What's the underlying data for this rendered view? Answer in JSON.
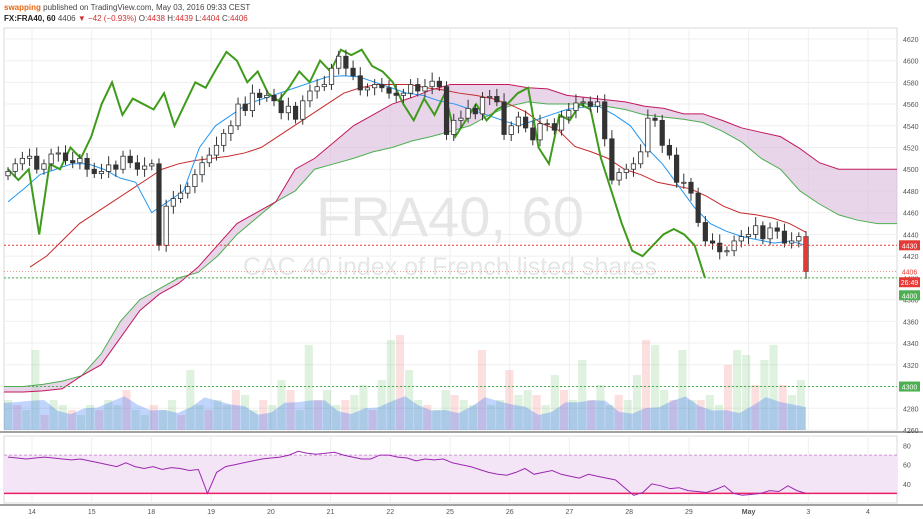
{
  "header": {
    "author": "swapping",
    "published_text": "published on TradingView.com, May 03, 2016 09:33 CEST",
    "symbol": "FX:FRA40, 60",
    "last": "4406",
    "change_arrow": "▼",
    "change": "−42 (−0.93%)",
    "o_label": "O:",
    "o": "4438",
    "h_label": "H:",
    "h": "4439",
    "l_label": "L:",
    "l": "4404",
    "c_label": "C:",
    "c": "4406"
  },
  "watermark": {
    "title": "FRA40, 60",
    "subtitle": "CAC 40 index of French listed shares"
  },
  "badges": {
    "level_upper": "4430",
    "last": "4406",
    "countdown": "26:49",
    "level_lower": "4400",
    "volume_level": "4300"
  },
  "colors": {
    "up": "#26a69a",
    "down": "#ef5350",
    "candle": "#333333",
    "lagging_span": "#3f9b1c",
    "cloud_fill": "#d7b2d9",
    "senkou_a": "#4caf50",
    "senkou_b": "#c2185b",
    "kijun": "#c62828",
    "tenkan": "#2196f3",
    "rsi": "#9c27b0",
    "rsi_band": "#f3e5f5"
  },
  "chart_data": {
    "type": "candlestick",
    "ylim": [
      4260,
      4630
    ],
    "y_ticks": [
      4260,
      4280,
      4300,
      4320,
      4340,
      4360,
      4380,
      4400,
      4420,
      4440,
      4460,
      4480,
      4500,
      4520,
      4540,
      4560,
      4580,
      4600,
      4620
    ],
    "x_ticks": [
      "14",
      "15",
      "18",
      "19",
      "20",
      "21",
      "22",
      "25",
      "26",
      "27",
      "28",
      "29",
      "May",
      "3",
      "4"
    ],
    "horizontal_lines": [
      4430,
      4400,
      4300
    ],
    "price_close": [
      4498,
      4505,
      4510,
      4512,
      4500,
      4505,
      4514,
      4515,
      4508,
      4506,
      4510,
      4500,
      4496,
      4498,
      4504,
      4500,
      4512,
      4506,
      4500,
      4503,
      4505,
      4430,
      4466,
      4473,
      4478,
      4484,
      4495,
      4506,
      4513,
      4522,
      4533,
      4540,
      4560,
      4554,
      4570,
      4566,
      4568,
      4563,
      4552,
      4558,
      4546,
      4563,
      4572,
      4576,
      4578,
      4593,
      4604,
      4593,
      4586,
      4573,
      4575,
      4578,
      4575,
      4570,
      4568,
      4570,
      4578,
      4572,
      4576,
      4581,
      4576,
      4532,
      4545,
      4547,
      4556,
      4551,
      4566,
      4567,
      4562,
      4532,
      4540,
      4548,
      4538,
      4527,
      4542,
      4542,
      4536,
      4548,
      4554,
      4561,
      4562,
      4558,
      4562,
      4528,
      4490,
      4497,
      4500,
      4505,
      4516,
      4547,
      4545,
      4522,
      4513,
      4488,
      4488,
      4478,
      4451,
      4434,
      4432,
      4424,
      4425,
      4434,
      4438,
      4440,
      4448,
      4436,
      4446,
      4443,
      4432,
      4434,
      4438,
      4406
    ],
    "senkou_a": [
      4300,
      4300,
      4302,
      4305,
      4310,
      4330,
      4360,
      4380,
      4390,
      4400,
      4405,
      4420,
      4440,
      4455,
      4470,
      4480,
      4500,
      4505,
      4510,
      4516,
      4520,
      4526,
      4530,
      4535,
      4540,
      4550,
      4558,
      4562,
      4560,
      4560,
      4560,
      4558,
      4555,
      4550,
      4548,
      4546,
      4543,
      4535,
      4525,
      4510,
      4500,
      4480,
      4468,
      4458,
      4453,
      4450,
      4450
    ],
    "senkou_b": [
      4295,
      4295,
      4296,
      4298,
      4310,
      4320,
      4345,
      4370,
      4385,
      4395,
      4410,
      4430,
      4450,
      4460,
      4470,
      4500,
      4510,
      4525,
      4540,
      4550,
      4560,
      4566,
      4573,
      4578,
      4578,
      4578,
      4578,
      4575,
      4574,
      4568,
      4566,
      4564,
      4562,
      4558,
      4556,
      4551,
      4551,
      4545,
      4538,
      4534,
      4530,
      4519,
      4506,
      4500,
      4500,
      4500,
      4500
    ],
    "kijun": [
      4410,
      4420,
      4435,
      4450,
      4460,
      4470,
      4480,
      4490,
      4500,
      4505,
      4508,
      4510,
      4512,
      4515,
      4520,
      4530,
      4540,
      4550,
      4560,
      4570,
      4575,
      4578,
      4578,
      4578,
      4575,
      4573,
      4570,
      4568,
      4565,
      4560,
      4553,
      4542,
      4536,
      4521,
      4516,
      4510,
      4500,
      4495,
      4488,
      4485,
      4482,
      4475,
      4466,
      4460,
      4458,
      4455,
      4450,
      4442
    ],
    "tenkan": [
      4470,
      4482,
      4495,
      4500,
      4505,
      4505,
      4500,
      4492,
      4488,
      4460,
      4470,
      4480,
      4520,
      4540,
      4550,
      4560,
      4565,
      4570,
      4575,
      4580,
      4585,
      4586,
      4585,
      4580,
      4575,
      4570,
      4568,
      4563,
      4560,
      4555,
      4550,
      4545,
      4540,
      4545,
      4550,
      4555,
      4557,
      4558,
      4550,
      4540,
      4520,
      4505,
      4485,
      4465,
      4450,
      4443,
      4438,
      4435,
      4432,
      4434,
      4430
    ],
    "lagging_span": [
      4500,
      4490,
      4500,
      4440,
      4505,
      4500,
      4520,
      4510,
      4530,
      4560,
      4580,
      4550,
      4565,
      4560,
      4555,
      4570,
      4540,
      4560,
      4580,
      4575,
      4592,
      4608,
      4600,
      4580,
      4590,
      4570,
      4563,
      4575,
      4590,
      4580,
      4600,
      4590,
      4610,
      4605,
      4610,
      4595,
      4590,
      4580,
      4560,
      4545,
      4565,
      4550,
      4570,
      4530,
      4545,
      4560,
      4545,
      4555,
      4560,
      4570,
      4575,
      4520,
      4505,
      4550,
      4545,
      4560,
      4555,
      4510,
      4480,
      4450,
      4425,
      4420,
      4430,
      4440,
      4445,
      4440,
      4430,
      4400
    ],
    "rsi": {
      "ylim": [
        20,
        90
      ],
      "ticks": [
        40,
        60,
        80
      ],
      "band": [
        30,
        70
      ],
      "values": [
        68,
        67,
        66,
        67,
        68,
        67,
        66,
        65,
        66,
        64,
        62,
        60,
        58,
        62,
        58,
        56,
        58,
        55,
        57,
        56,
        54,
        55,
        30,
        52,
        58,
        60,
        62,
        64,
        66,
        67,
        68,
        70,
        74,
        72,
        71,
        72,
        73,
        70,
        68,
        66,
        66,
        70,
        70,
        68,
        67,
        64,
        66,
        65,
        66,
        62,
        60,
        58,
        55,
        52,
        50,
        49,
        52,
        56,
        50,
        52,
        54,
        50,
        48,
        46,
        50,
        48,
        46,
        44,
        36,
        28,
        31,
        40,
        38,
        35,
        36,
        33,
        32,
        31,
        34,
        38,
        30,
        28,
        29,
        30,
        33,
        32,
        38,
        33,
        30
      ]
    },
    "volume": {
      "ylim": [
        0,
        100
      ],
      "values": [
        30,
        25,
        20,
        80,
        15,
        30,
        25,
        20,
        15,
        25,
        20,
        30,
        25,
        40,
        20,
        15,
        25,
        20,
        30,
        15,
        60,
        25,
        20,
        30,
        25,
        40,
        35,
        20,
        30,
        25,
        50,
        40,
        20,
        85,
        30,
        40,
        25,
        30,
        35,
        45,
        20,
        50,
        90,
        95,
        60,
        30,
        25,
        20,
        40,
        35,
        30,
        25,
        80,
        25,
        30,
        60,
        35,
        40,
        35,
        25,
        55,
        40,
        30,
        70,
        30,
        45,
        25,
        35,
        30,
        55,
        90,
        85,
        40,
        30,
        80,
        30,
        30,
        35,
        25,
        65,
        80,
        75,
        45,
        70,
        85,
        45,
        35,
        50
      ]
    }
  }
}
